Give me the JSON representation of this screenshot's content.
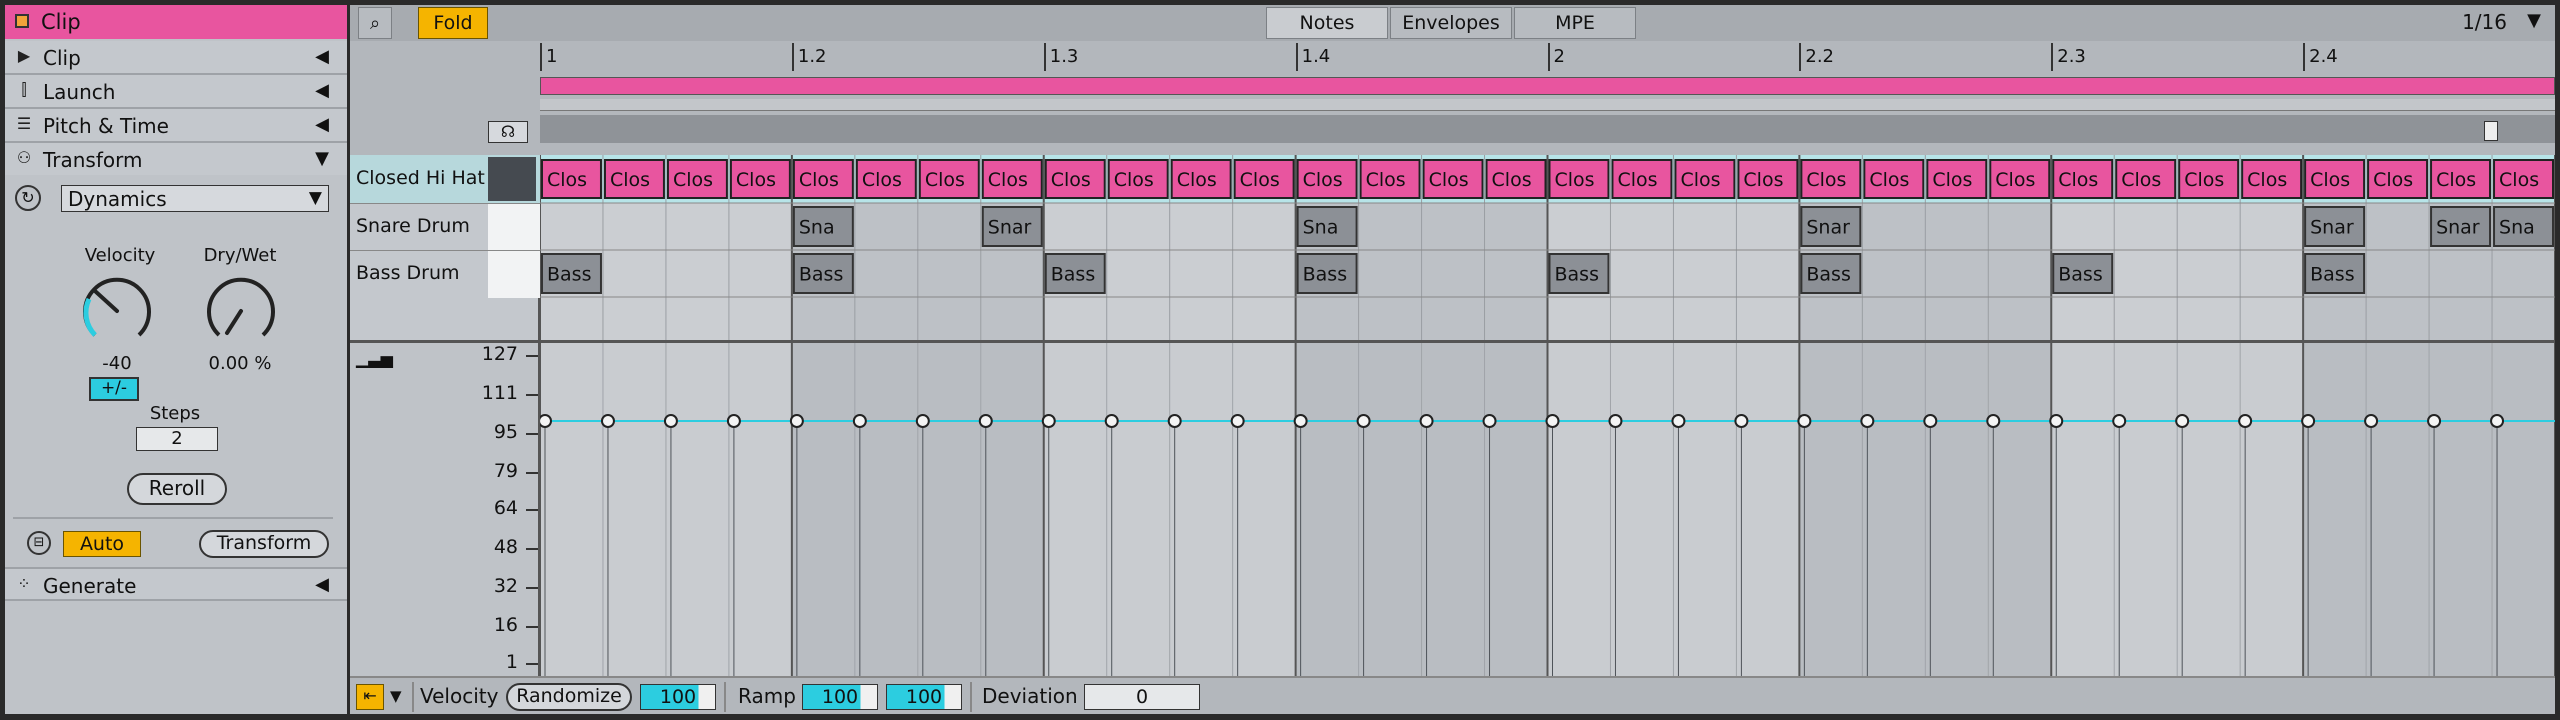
{
  "sidebar": {
    "clip_title": "Clip",
    "sections": [
      {
        "label": "Clip",
        "icon": "play-icon"
      },
      {
        "label": "Launch",
        "icon": "launch-icon"
      },
      {
        "label": "Pitch & Time",
        "icon": "sliders-icon"
      },
      {
        "label": "Transform",
        "icon": "transform-icon"
      }
    ],
    "transform": {
      "device": "Dynamics",
      "velocity_label": "Velocity",
      "velocity_value": "-40",
      "plusminus": "+/-",
      "drywet_label": "Dry/Wet",
      "drywet_value": "0.00 %",
      "steps_label": "Steps",
      "steps_value": "2",
      "reroll": "Reroll",
      "auto": "Auto",
      "transform_btn": "Transform"
    },
    "generate": "Generate"
  },
  "toolbar": {
    "fold": "Fold",
    "tabs": [
      "Notes",
      "Envelopes",
      "MPE"
    ],
    "grid": "1/16"
  },
  "ruler": {
    "bars": [
      "1",
      "1.2",
      "1.3",
      "1.4",
      "2",
      "2.2",
      "2.3",
      "2.4"
    ]
  },
  "lanes": [
    {
      "name": "Closed Hi Hat",
      "note_label": "Clos",
      "steps": [
        0,
        1,
        2,
        3,
        4,
        5,
        6,
        7,
        8,
        9,
        10,
        11,
        12,
        13,
        14,
        15,
        16,
        17,
        18,
        19,
        20,
        21,
        22,
        23,
        24,
        25,
        26,
        27,
        28,
        29,
        30,
        31
      ]
    },
    {
      "name": "Snare Drum",
      "notes": [
        {
          "step": 4,
          "label": "Sna"
        },
        {
          "step": 7,
          "label": "Snar"
        },
        {
          "step": 12,
          "label": "Sna"
        },
        {
          "step": 20,
          "label": "Snar"
        },
        {
          "step": 28,
          "label": "Snar"
        },
        {
          "step": 30,
          "label": "Snar"
        },
        {
          "step": 31,
          "label": "Sna"
        }
      ]
    },
    {
      "name": "Bass Drum",
      "notes": [
        {
          "step": 0,
          "label": "Bass"
        },
        {
          "step": 4,
          "label": "Bass"
        },
        {
          "step": 8,
          "label": "Bass"
        },
        {
          "step": 12,
          "label": "Bass"
        },
        {
          "step": 16,
          "label": "Bass"
        },
        {
          "step": 20,
          "label": "Bass"
        },
        {
          "step": 24,
          "label": "Bass"
        },
        {
          "step": 28,
          "label": "Bass"
        }
      ]
    }
  ],
  "velocity_editor": {
    "scale": [
      "127",
      "111",
      "95",
      "79",
      "64",
      "48",
      "32",
      "16",
      "1"
    ],
    "note_velocity": 100
  },
  "bottom": {
    "velocity_label": "Velocity",
    "randomize": "Randomize",
    "velocity_value": "100",
    "ramp_label": "Ramp",
    "ramp_start": "100",
    "ramp_end": "100",
    "deviation_label": "Deviation",
    "deviation_value": "0"
  },
  "colors": {
    "clip": "#e8559f",
    "accent": "#f5b400",
    "cyan": "#2ccde0"
  }
}
